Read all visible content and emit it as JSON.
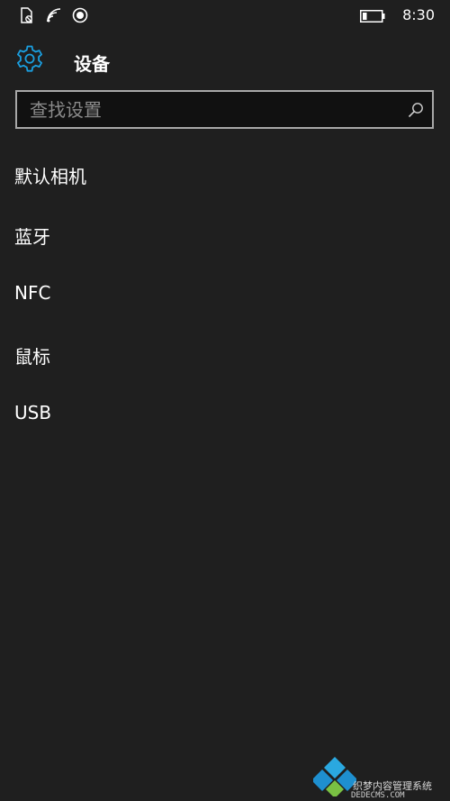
{
  "status_bar": {
    "icons": [
      "sim-off-icon",
      "wifi-icon",
      "location-icon",
      "battery-icon"
    ],
    "time": "8:30",
    "battery_level": 0.2
  },
  "header": {
    "icon": "gear-icon",
    "title": "设备"
  },
  "search": {
    "placeholder": "查找设置",
    "value": "",
    "icon": "search-icon"
  },
  "menu": {
    "items": [
      {
        "label": "默认相机"
      },
      {
        "label": "蓝牙"
      },
      {
        "label": "NFC"
      },
      {
        "label": "鼠标"
      },
      {
        "label": "USB"
      }
    ]
  },
  "watermark": {
    "line1": "织梦内容管理系统",
    "line2": "DEDECMS.COM"
  },
  "colors": {
    "background": "#1f1f1f",
    "accent": "#1a9fe0",
    "text": "#ffffff",
    "search_border": "#a8a8a8"
  }
}
